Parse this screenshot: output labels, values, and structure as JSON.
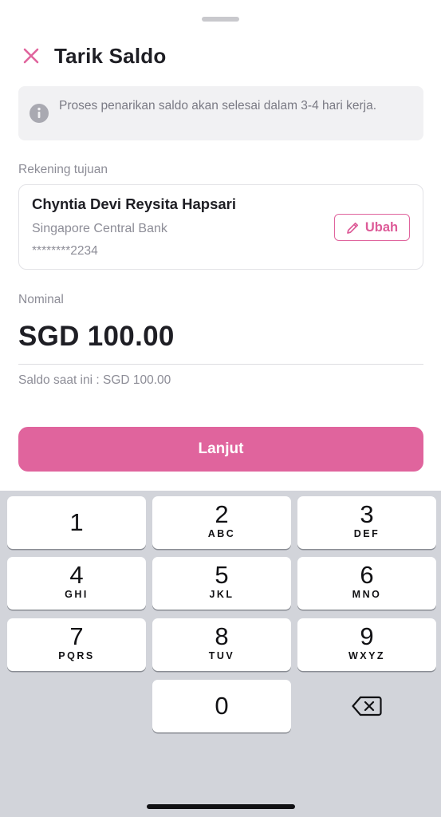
{
  "header": {
    "title": "Tarik Saldo",
    "close_icon": "close-icon"
  },
  "info": {
    "icon": "info-icon",
    "text": "Proses penarikan saldo akan selesai dalam 3-4 hari kerja."
  },
  "destination": {
    "label": "Rekening tujuan",
    "account_name": "Chyntia Devi Reysita Hapsari",
    "bank_name": "Singapore Central Bank",
    "account_number": "********2234",
    "edit_label": "Ubah",
    "edit_icon": "pencil-icon"
  },
  "nominal": {
    "label": "Nominal",
    "amount": "SGD 100.00",
    "balance_text": "Saldo saat ini : SGD 100.00"
  },
  "actions": {
    "continue_label": "Lanjut"
  },
  "keypad": {
    "keys": [
      {
        "digit": "1",
        "letters": ""
      },
      {
        "digit": "2",
        "letters": "ABC"
      },
      {
        "digit": "3",
        "letters": "DEF"
      },
      {
        "digit": "4",
        "letters": "GHI"
      },
      {
        "digit": "5",
        "letters": "JKL"
      },
      {
        "digit": "6",
        "letters": "MNO"
      },
      {
        "digit": "7",
        "letters": "PQRS"
      },
      {
        "digit": "8",
        "letters": "TUV"
      },
      {
        "digit": "9",
        "letters": "WXYZ"
      },
      {
        "digit": "0",
        "letters": ""
      }
    ],
    "backspace_icon": "backspace-icon"
  },
  "colors": {
    "accent": "#e0649d",
    "text_primary": "#1e1e24",
    "text_secondary": "#8d8d97",
    "keyboard_bg": "#d2d4da"
  }
}
